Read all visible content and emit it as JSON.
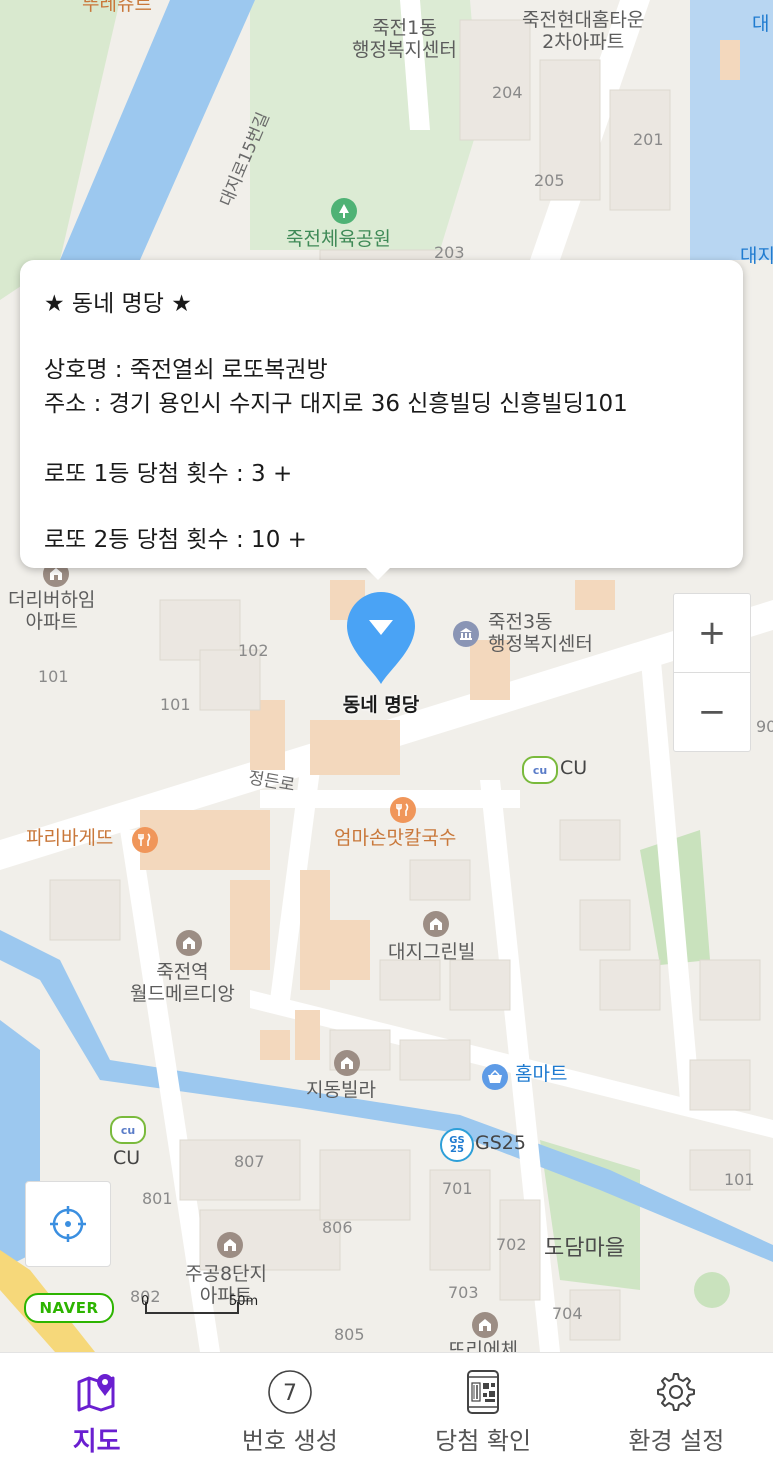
{
  "popup": {
    "title": "★ 동네 명당 ★",
    "shop_line": "상호명 : 죽전열쇠 로또복권방",
    "address_line": "주소 : 경기 용인시 수지구 대지로 36 신흥빌딩 신흥빌딩101",
    "first_prize_line": "로또 1등 당첨 횟수 :  3 +",
    "second_prize_line": "로또 2등 당첨 횟수 :  10 +"
  },
  "marker": {
    "label": "동네 명당",
    "color": "#4aa3f5"
  },
  "map": {
    "labels": {
      "top_cut": "뚜레쥬르",
      "gov1": "죽전1동\n행정복지센터",
      "apt_top": "죽전현대홈타운\n2차아파트",
      "bldg_204": "204",
      "bldg_201": "201",
      "bldg_205": "205",
      "bldg_203": "203",
      "road_15": "대지로15번길",
      "park": "죽전체육공원",
      "right_top_1": "대",
      "right_top_2": "대지",
      "apt_left": "더리버하임\n아파트",
      "b102": "102",
      "b101a": "101",
      "b101b": "101",
      "b90": "90",
      "gov3": "죽전3동\n행정복지센터",
      "cu_top": "CU",
      "road_jeong": "정든로",
      "paris": "파리바게뜨",
      "eomma": "엄마손맛칼국수",
      "daeji_green": "대지그린빌",
      "world": "죽전역\n월드메르디앙",
      "homemart": "홈마트",
      "jidong": "지동빌라",
      "gs25": "GS25",
      "cu_bottom": "CU",
      "b807": "807",
      "b801": "801",
      "b806": "806",
      "b701": "701",
      "b702": "702",
      "b703": "703",
      "b704": "704",
      "b101c": "101",
      "b802": "802",
      "b805": "805",
      "dodam": "도담마을",
      "jugong": "주공8단지\n아파트",
      "bottom_cut": "뜨리에체"
    },
    "zoom_in": "+",
    "zoom_out": "−",
    "naver_logo": "NAVER",
    "scale_zero": "0",
    "scale_distance": "50m"
  },
  "tabbar": {
    "tabs": [
      {
        "label": "지도",
        "icon": "map-pin-icon",
        "active": true
      },
      {
        "label": "번호 생성",
        "icon": "number-seven-icon",
        "number": "7",
        "active": false
      },
      {
        "label": "당첨 확인",
        "icon": "qr-phone-icon",
        "active": false
      },
      {
        "label": "환경 설정",
        "icon": "gear-icon",
        "active": false
      }
    ],
    "active_color": "#6a1fd0"
  }
}
